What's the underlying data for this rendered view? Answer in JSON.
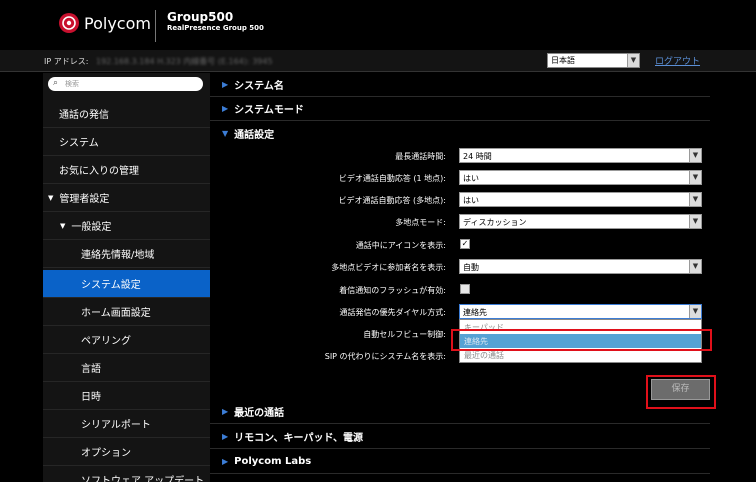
{
  "header": {
    "brand": "Polycom",
    "device_title": "Group500",
    "device_subtitle": "RealPresence Group 500"
  },
  "infobar": {
    "ip_label": "IP アドレス:",
    "ip_value": "192.168.3.184   H.323 内線番号 (E.164): 3945",
    "language": "日本語",
    "logout": "ログアウト"
  },
  "sidebar": {
    "search_placeholder": "検索",
    "items": [
      {
        "label": "通話の発信"
      },
      {
        "label": "システム"
      },
      {
        "label": "お気に入りの管理"
      },
      {
        "label": "管理者設定"
      },
      {
        "label": "一般設定"
      },
      {
        "label": "連絡先情報/地域"
      },
      {
        "label": "システム設定"
      },
      {
        "label": "ホーム画面設定"
      },
      {
        "label": "ペアリング"
      },
      {
        "label": "言語"
      },
      {
        "label": "日時"
      },
      {
        "label": "シリアルポート"
      },
      {
        "label": "オプション"
      },
      {
        "label": "ソフトウェア アップデート"
      }
    ]
  },
  "sections": {
    "system_name": "システム名",
    "system_mode": "システムモード",
    "call_settings": "通話設定",
    "recent_calls": "最近の通話",
    "remote": "リモコン、キーパッド、電源",
    "labs": "Polycom Labs"
  },
  "form": {
    "max_call_time_label": "最長通話時間:",
    "max_call_time_value": "24 時間",
    "auto_answer_p2p_label": "ビデオ通話自動応答 (1 地点):",
    "auto_answer_p2p_value": "はい",
    "auto_answer_mp_label": "ビデオ通話自動応答 (多地点):",
    "auto_answer_mp_value": "はい",
    "multipoint_mode_label": "多地点モード:",
    "multipoint_mode_value": "ディスカッション",
    "show_icons_label": "通話中にアイコンを表示:",
    "show_names_label": "多地点ビデオに参加者名を表示:",
    "show_names_value": "自動",
    "flash_label": "着信通知のフラッシュが有効:",
    "preferred_dial_label": "通話発信の優先ダイヤル方式:",
    "preferred_dial_value": "連絡先",
    "auto_selfview_label": "自動セルフビュー制御:",
    "sip_name_label": "SIP の代わりにシステム名を表示:",
    "dropdown_options": [
      "キーパッド",
      "連絡先",
      "最近の通話"
    ],
    "save": "保存"
  },
  "colors": {
    "accent": "#0a62c8",
    "highlight": "#e0101a",
    "link": "#5b8fd6"
  }
}
